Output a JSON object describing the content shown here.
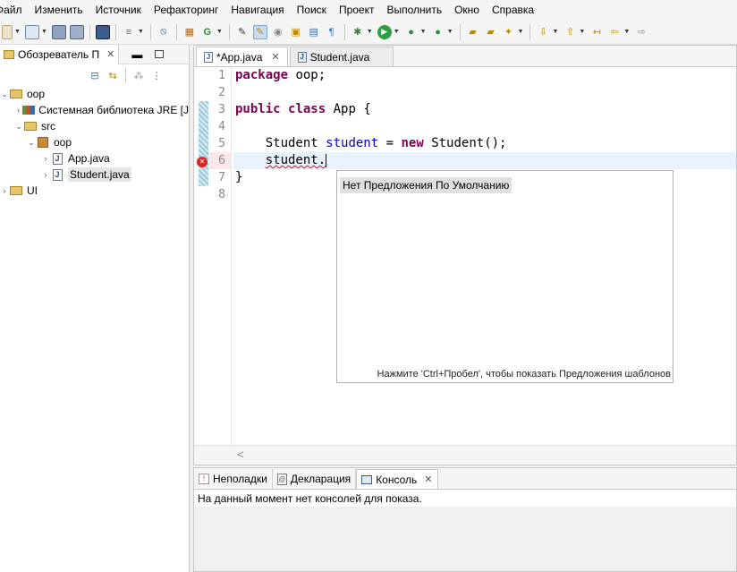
{
  "menu": [
    "Файл",
    "Изменить",
    "Источник",
    "Рефакторинг",
    "Навигация",
    "Поиск",
    "Проект",
    "Выполнить",
    "Окно",
    "Справка"
  ],
  "explorer": {
    "tab_label": "Обозреватель П",
    "tree": [
      {
        "label": "oop",
        "depth": 0,
        "icon": "project-icon",
        "arrow": "v"
      },
      {
        "label": "Системная библиотека JRE [J",
        "depth": 1,
        "icon": "library-icon",
        "arrow": ">"
      },
      {
        "label": "src",
        "depth": 1,
        "icon": "source-folder-icon",
        "arrow": "v"
      },
      {
        "label": "oop",
        "depth": 2,
        "icon": "package-icon",
        "arrow": "v"
      },
      {
        "label": "App.java",
        "depth": 3,
        "icon": "java-file-icon",
        "arrow": ">"
      },
      {
        "label": "Student.java",
        "depth": 3,
        "icon": "java-file-icon",
        "arrow": ">",
        "selected": true
      },
      {
        "label": "UI",
        "depth": 0,
        "icon": "project-icon",
        "arrow": ">"
      }
    ]
  },
  "editor": {
    "tabs": [
      {
        "label": "*App.java",
        "active": true,
        "closable": true
      },
      {
        "label": "Student.java",
        "active": false,
        "closable": false
      }
    ],
    "line_numbers": [
      "1",
      "2",
      "3",
      "4",
      "5",
      "6",
      "7",
      "8"
    ],
    "code": {
      "l1_kw": "package",
      "l1_rest": " oop;",
      "l3_kw1": "public",
      "l3_kw2": "class",
      "l3_rest": " App {",
      "l5_type": "    Student ",
      "l5_var": "student",
      "l5_eq": " = ",
      "l5_kw": "new",
      "l5_rest": " Student();",
      "l6_indent": "    ",
      "l6_err": "student.",
      "l7": "}"
    },
    "completion": {
      "item": "Нет Предложения По Умолчанию",
      "hint": "Нажмите 'Ctrl+Пробел', чтобы показать Предложения шаблонов"
    },
    "scroll_arrow": "<"
  },
  "bottom": {
    "tabs": [
      {
        "label": "Неполадки",
        "icon": "problems-icon",
        "active": false
      },
      {
        "label": "Декларация",
        "icon": "declaration-icon",
        "active": false
      },
      {
        "label": "Консоль",
        "icon": "console-icon",
        "active": true
      }
    ],
    "message": "На данный момент нет консолей для показа."
  },
  "colors": {
    "keyword": "#7f0055",
    "variable": "#0000c0",
    "error": "#ff0000"
  }
}
